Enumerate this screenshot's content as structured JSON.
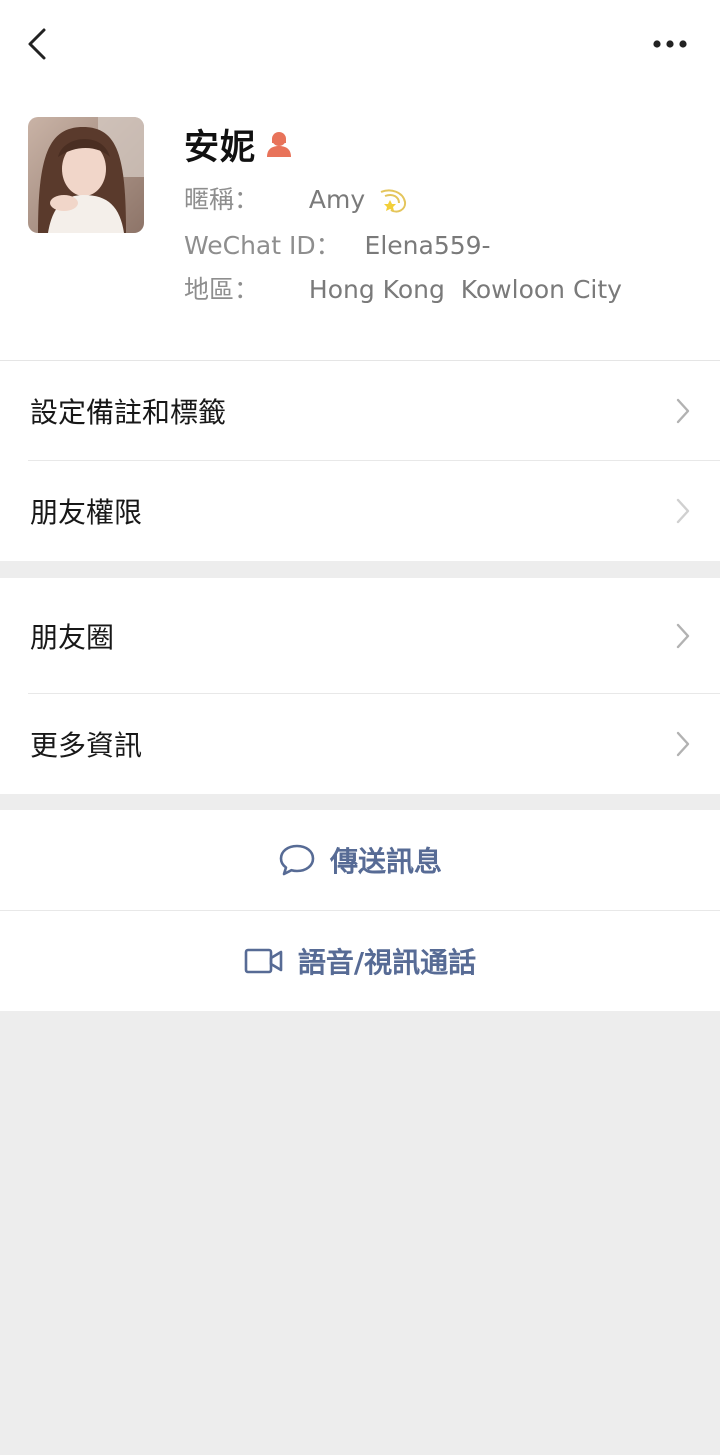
{
  "profile": {
    "name": "安妮",
    "nickname_label": "暱稱：",
    "nickname_value": "Amy",
    "wechat_id_label": "WeChat ID：",
    "wechat_id_value": "Elena559-",
    "region_label": "地區：",
    "region_value": "Hong Kong  Kowloon City"
  },
  "menu": {
    "set_remarks": "設定備註和標籤",
    "friend_permissions": "朋友權限",
    "moments": "朋友圈",
    "more_info": "更多資訊"
  },
  "actions": {
    "send_message": "傳送訊息",
    "voice_video_call": "語音/視訊通話"
  },
  "icons": {
    "back": "back-chevron-icon",
    "more": "more-dots-icon",
    "gender": "female-icon",
    "nickname_emoji": "dizzy-star-icon",
    "chevron": "chevron-right-icon",
    "message": "chat-bubble-icon",
    "video": "video-camera-icon"
  },
  "colors": {
    "accent": "#576b95",
    "gender": "#e8735a",
    "background": "#ededed"
  }
}
